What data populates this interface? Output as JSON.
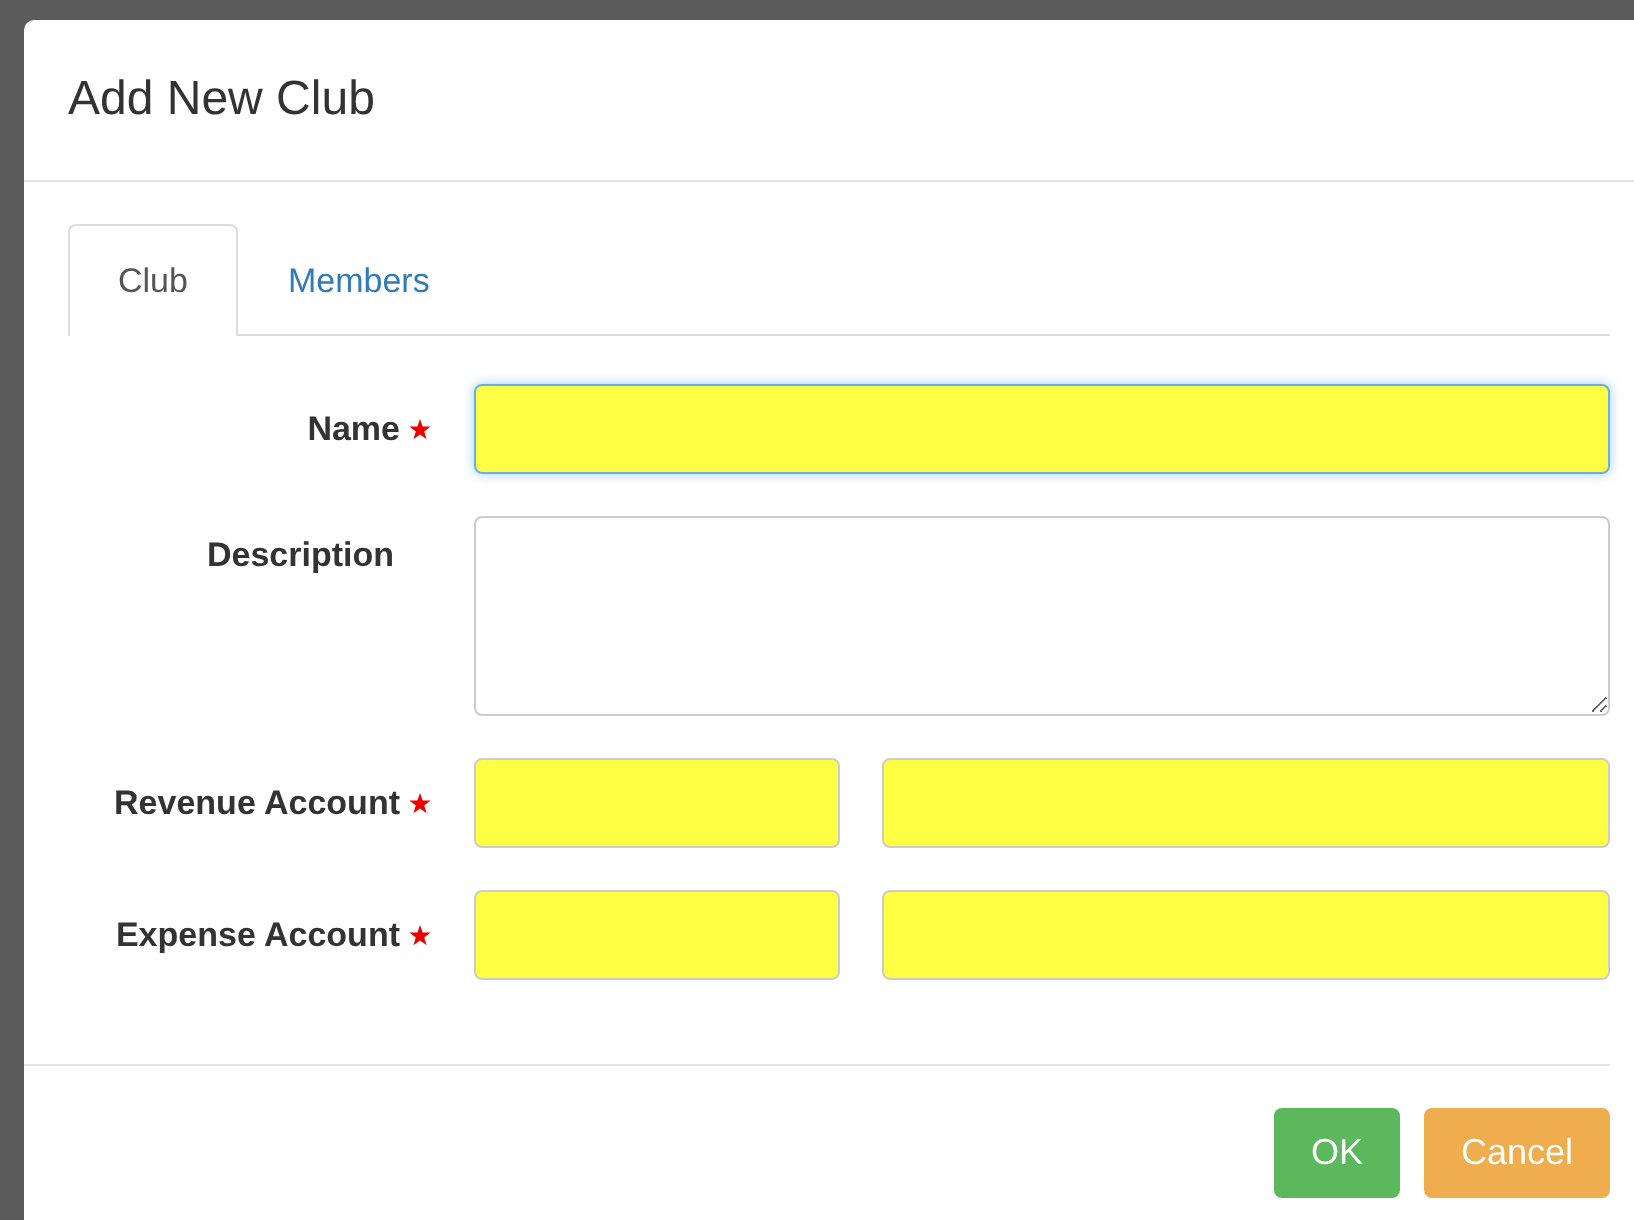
{
  "dialog": {
    "title": "Add New Club"
  },
  "tabs": [
    {
      "label": "Club",
      "selected": true
    },
    {
      "label": "Members",
      "selected": false
    }
  ],
  "fields": [
    {
      "label": "Name",
      "kind": "input",
      "required": true,
      "highlighted": true,
      "focused": true
    },
    {
      "label": "Description",
      "kind": "textarea",
      "required": false,
      "highlighted": false,
      "focused": false
    },
    {
      "label": "Revenue Account",
      "kind": "account",
      "required": true,
      "highlighted": true,
      "focused": false
    },
    {
      "label": "Expense Account",
      "kind": "account",
      "required": true,
      "highlighted": true,
      "focused": false
    }
  ],
  "buttons": [
    {
      "label": "OK",
      "kind": "primary"
    },
    {
      "label": "Cancel",
      "kind": "warning"
    }
  ]
}
